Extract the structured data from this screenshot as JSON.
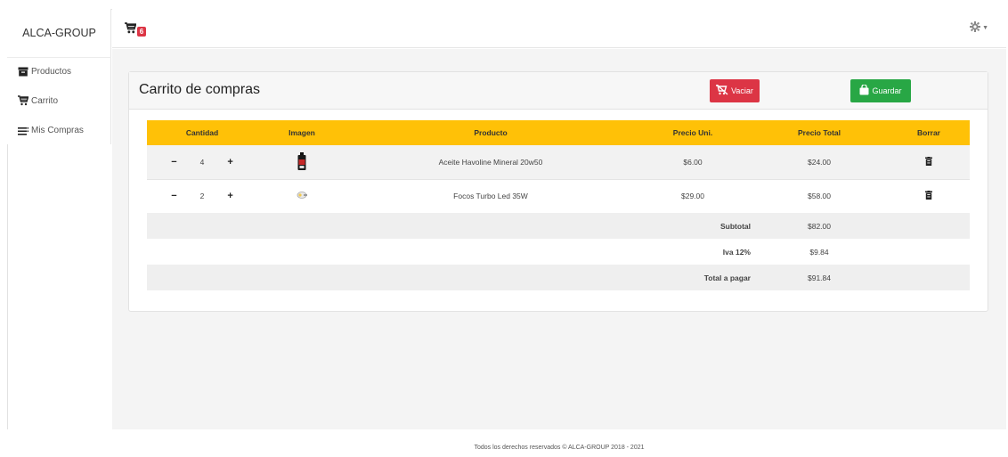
{
  "brand": "ALCA-GROUP",
  "sidebar": {
    "items": [
      {
        "label": "Productos",
        "icon": "archive-icon"
      },
      {
        "label": "Carrito",
        "icon": "cart-icon"
      },
      {
        "label": "Mis Compras",
        "icon": "list-icon"
      }
    ]
  },
  "topbar": {
    "cart_count": "6",
    "settings_icon": "gear-icon"
  },
  "card": {
    "title": "Carrito de compras",
    "clear_label": "Vaciar",
    "save_label": "Guardar"
  },
  "table": {
    "headers": [
      "Cantidad",
      "Imagen",
      "Producto",
      "Precio Uni.",
      "Precio Total",
      "Borrar"
    ],
    "rows": [
      {
        "qty": "4",
        "product": "Aceite Havoline Mineral 20w50",
        "unit_price": "$6.00",
        "total": "$24.00"
      },
      {
        "qty": "2",
        "product": "Focos Turbo Led 35W",
        "unit_price": "$29.00",
        "total": "$58.00"
      }
    ],
    "summary": [
      {
        "label": "Subtotal",
        "value": "$82.00"
      },
      {
        "label": "Iva 12%",
        "value": "$9.84"
      },
      {
        "label": "Total a pagar",
        "value": "$91.84"
      }
    ],
    "minus": "−",
    "plus": "+"
  },
  "footer": "Todos los derechos reservados © ALCA-GROUP 2018 - 2021",
  "colors": {
    "header_yellow": "#ffc107",
    "danger": "#dc3545",
    "success": "#28a745"
  }
}
